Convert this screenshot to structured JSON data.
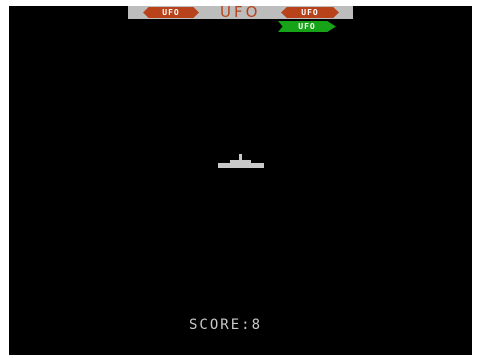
{
  "game": {
    "title": "UFO",
    "score_label": "SCORE:",
    "score_value": "8",
    "ufo_indicators": [
      {
        "label": "UFO",
        "color": "#b8431b"
      },
      {
        "label": "UFO",
        "color": "#b8431b"
      },
      {
        "label": "UFO",
        "color": "#16a318"
      }
    ]
  },
  "colors": {
    "background": "#000000",
    "title_bar": "#bdbdbd",
    "title_text": "#b8431b",
    "score_text": "#c9c9c9",
    "ship": "#c9c9c9"
  }
}
